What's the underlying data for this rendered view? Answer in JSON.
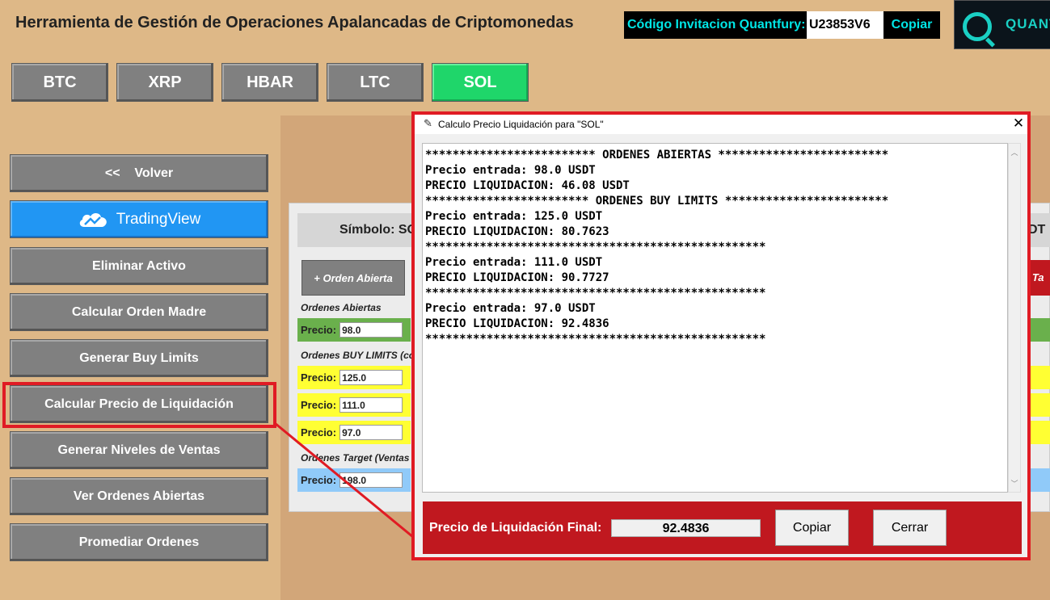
{
  "header": {
    "title": "Herramienta de Gestión de Operaciones Apalancadas de Criptomonedas",
    "invite_label": "Código Invitacion Quantfury:",
    "invite_code": "U23853V6",
    "invite_copy": "Copiar",
    "logo_text": "QUANT"
  },
  "coins": [
    "BTC",
    "XRP",
    "HBAR",
    "LTC",
    "SOL"
  ],
  "active_coin": "SOL",
  "sidebar": {
    "back": "<<    Volver",
    "tradingview": "TradingView",
    "buttons": [
      "Eliminar Activo",
      "Calcular Orden Madre",
      "Generar Buy Limits",
      "Calcular Precio de Liquidación",
      "Generar Niveles de Ventas",
      "Ver Ordenes Abiertas",
      "Promediar Ordenes"
    ]
  },
  "panel": {
    "symbol": "Símbolo: SO",
    "usdt_tail": "DT",
    "add_order": "+ Orden Abierta",
    "red_button_tail": "s Ta",
    "open_orders_label": "Ordenes Abiertas",
    "buy_limits_label": "Ordenes BUY LIMITS (co",
    "target_label": "Ordenes Target (Ventas",
    "price_label": "Precio:",
    "open_price": "98.0",
    "buy_limit_prices": [
      "125.0",
      "111.0",
      "97.0"
    ],
    "target_price": "198.0"
  },
  "dialog": {
    "title": "Calculo Precio Liquidación para \"SOL\"",
    "output_lines": [
      "************************* ORDENES ABIERTAS *************************",
      "Precio entrada: 98.0 USDT",
      "PRECIO LIQUIDACION: 46.08 USDT",
      "************************ ORDENES BUY LIMITS ************************",
      "Precio entrada: 125.0 USDT",
      "PRECIO LIQUIDACION: 80.7623",
      "**************************************************",
      "Precio entrada: 111.0 USDT",
      "PRECIO LIQUIDACION: 90.7727",
      "**************************************************",
      "Precio entrada: 97.0 USDT",
      "PRECIO LIQUIDACION: 92.4836",
      "**************************************************"
    ],
    "final_label": "Precio de Liquidación Final:",
    "final_value": "92.4836",
    "copy_button": "Copiar",
    "close_button": "Cerrar"
  },
  "colors": {
    "background": "#deb887",
    "active_tab": "#1fd66a",
    "tradingview": "#2196f3",
    "highlight": "#e01b24",
    "dialog_footer": "#c0181f"
  }
}
